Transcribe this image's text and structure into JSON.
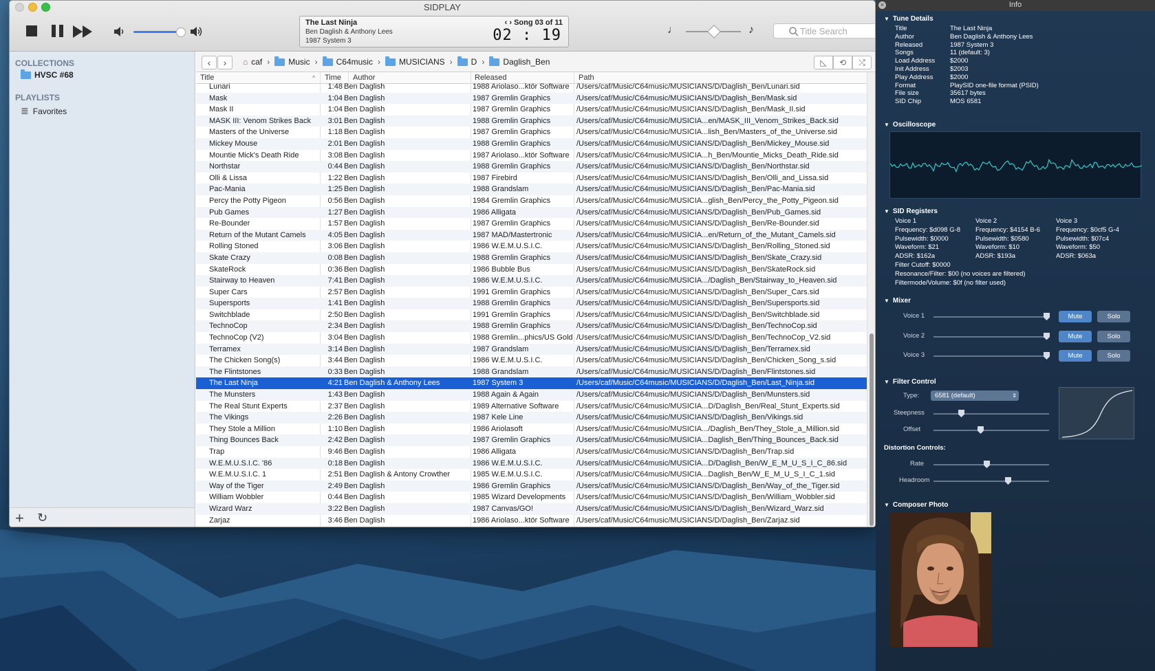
{
  "window": {
    "title": "SIDPLAY"
  },
  "now_playing": {
    "title": "The Last Ninja",
    "author": "Ben Daglish & Anthony Lees",
    "released": "1987 System 3",
    "song": "Song 03 of 11",
    "time": "02 : 19"
  },
  "search": {
    "placeholder": "Title Search"
  },
  "sidebar": {
    "collections_header": "COLLECTIONS",
    "collection": "HVSC #68",
    "playlists_header": "PLAYLISTS",
    "playlist": "Favorites"
  },
  "breadcrumb": [
    "caf",
    "Music",
    "C64music",
    "MUSICIANS",
    "D",
    "Daglish_Ben"
  ],
  "columns": {
    "title": "Title",
    "time": "Time",
    "author": "Author",
    "released": "Released",
    "path": "Path"
  },
  "rows": [
    [
      "Lunari",
      "1:48",
      "Ben Daglish",
      "1988 Ariolaso...ktör Software",
      "/Users/caf/Music/C64music/MUSICIANS/D/Daglish_Ben/Lunari.sid"
    ],
    [
      "Mask",
      "1:04",
      "Ben Daglish",
      "1987 Gremlin Graphics",
      "/Users/caf/Music/C64music/MUSICIANS/D/Daglish_Ben/Mask.sid"
    ],
    [
      "Mask II",
      "1:04",
      "Ben Daglish",
      "1987 Gremlin Graphics",
      "/Users/caf/Music/C64music/MUSICIANS/D/Daglish_Ben/Mask_II.sid"
    ],
    [
      "MASK III: Venom Strikes Back",
      "3:01",
      "Ben Daglish",
      "1988 Gremlin Graphics",
      "/Users/caf/Music/C64music/MUSICIA...en/MASK_III_Venom_Strikes_Back.sid"
    ],
    [
      "Masters of the Universe",
      "1:18",
      "Ben Daglish",
      "1987 Gremlin Graphics",
      "/Users/caf/Music/C64music/MUSICIA...lish_Ben/Masters_of_the_Universe.sid"
    ],
    [
      "Mickey Mouse",
      "2:01",
      "Ben Daglish",
      "1988 Gremlin Graphics",
      "/Users/caf/Music/C64music/MUSICIANS/D/Daglish_Ben/Mickey_Mouse.sid"
    ],
    [
      "Mountie Mick's Death Ride",
      "3:08",
      "Ben Daglish",
      "1987 Ariolaso...ktör Software",
      "/Users/caf/Music/C64music/MUSICIA...h_Ben/Mountie_Micks_Death_Ride.sid"
    ],
    [
      "Northstar",
      "0:44",
      "Ben Daglish",
      "1988 Gremlin Graphics",
      "/Users/caf/Music/C64music/MUSICIANS/D/Daglish_Ben/Northstar.sid"
    ],
    [
      "Olli & Lissa",
      "1:22",
      "Ben Daglish",
      "1987 Firebird",
      "/Users/caf/Music/C64music/MUSICIANS/D/Daglish_Ben/Olli_and_Lissa.sid"
    ],
    [
      "Pac-Mania",
      "1:25",
      "Ben Daglish",
      "1988 Grandslam",
      "/Users/caf/Music/C64music/MUSICIANS/D/Daglish_Ben/Pac-Mania.sid"
    ],
    [
      "Percy the Potty Pigeon",
      "0:56",
      "Ben Daglish",
      "1984 Gremlin Graphics",
      "/Users/caf/Music/C64music/MUSICIA...glish_Ben/Percy_the_Potty_Pigeon.sid"
    ],
    [
      "Pub Games",
      "1:27",
      "Ben Daglish",
      "1986 Alligata",
      "/Users/caf/Music/C64music/MUSICIANS/D/Daglish_Ben/Pub_Games.sid"
    ],
    [
      "Re-Bounder",
      "1:57",
      "Ben Daglish",
      "1987 Gremlin Graphics",
      "/Users/caf/Music/C64music/MUSICIANS/D/Daglish_Ben/Re-Bounder.sid"
    ],
    [
      "Return of the Mutant Camels",
      "4:05",
      "Ben Daglish",
      "1987 MAD/Mastertronic",
      "/Users/caf/Music/C64music/MUSICIA...en/Return_of_the_Mutant_Camels.sid"
    ],
    [
      "Rolling Stoned",
      "3:06",
      "Ben Daglish",
      "1986 W.E.M.U.S.I.C.",
      "/Users/caf/Music/C64music/MUSICIANS/D/Daglish_Ben/Rolling_Stoned.sid"
    ],
    [
      "Skate Crazy",
      "0:08",
      "Ben Daglish",
      "1988 Gremlin Graphics",
      "/Users/caf/Music/C64music/MUSICIANS/D/Daglish_Ben/Skate_Crazy.sid"
    ],
    [
      "SkateRock",
      "0:36",
      "Ben Daglish",
      "1986 Bubble Bus",
      "/Users/caf/Music/C64music/MUSICIANS/D/Daglish_Ben/SkateRock.sid"
    ],
    [
      "Stairway to Heaven",
      "7:41",
      "Ben Daglish",
      "1986 W.E.M.U.S.I.C.",
      "/Users/caf/Music/C64music/MUSICIA.../Daglish_Ben/Stairway_to_Heaven.sid"
    ],
    [
      "Super Cars",
      "2:57",
      "Ben Daglish",
      "1991 Gremlin Graphics",
      "/Users/caf/Music/C64music/MUSICIANS/D/Daglish_Ben/Super_Cars.sid"
    ],
    [
      "Supersports",
      "1:41",
      "Ben Daglish",
      "1988 Gremlin Graphics",
      "/Users/caf/Music/C64music/MUSICIANS/D/Daglish_Ben/Supersports.sid"
    ],
    [
      "Switchblade",
      "2:50",
      "Ben Daglish",
      "1991 Gremlin Graphics",
      "/Users/caf/Music/C64music/MUSICIANS/D/Daglish_Ben/Switchblade.sid"
    ],
    [
      "TechnoCop",
      "2:34",
      "Ben Daglish",
      "1988 Gremlin Graphics",
      "/Users/caf/Music/C64music/MUSICIANS/D/Daglish_Ben/TechnoCop.sid"
    ],
    [
      "TechnoCop (V2)",
      "3:04",
      "Ben Daglish",
      "1988 Gremlin...phics/US Gold",
      "/Users/caf/Music/C64music/MUSICIANS/D/Daglish_Ben/TechnoCop_V2.sid"
    ],
    [
      "Terramex",
      "3:14",
      "Ben Daglish",
      "1987 Grandslam",
      "/Users/caf/Music/C64music/MUSICIANS/D/Daglish_Ben/Terramex.sid"
    ],
    [
      "The Chicken Song(s)",
      "3:44",
      "Ben Daglish",
      "1986 W.E.M.U.S.I.C.",
      "/Users/caf/Music/C64music/MUSICIANS/D/Daglish_Ben/Chicken_Song_s.sid"
    ],
    [
      "The Flintstones",
      "0:33",
      "Ben Daglish",
      "1988 Grandslam",
      "/Users/caf/Music/C64music/MUSICIANS/D/Daglish_Ben/Flintstones.sid"
    ],
    [
      "The Last Ninja",
      "4:21",
      "Ben Daglish & Anthony Lees",
      "1987 System 3",
      "/Users/caf/Music/C64music/MUSICIANS/D/Daglish_Ben/Last_Ninja.sid"
    ],
    [
      "The Munsters",
      "1:43",
      "Ben Daglish",
      "1988 Again & Again",
      "/Users/caf/Music/C64music/MUSICIANS/D/Daglish_Ben/Munsters.sid"
    ],
    [
      "The Real Stunt Experts",
      "2:37",
      "Ben Daglish",
      "1989 Alternative Software",
      "/Users/caf/Music/C64music/MUSICIA...D/Daglish_Ben/Real_Stunt_Experts.sid"
    ],
    [
      "The Vikings",
      "2:26",
      "Ben Daglish",
      "1987 Kele Line",
      "/Users/caf/Music/C64music/MUSICIANS/D/Daglish_Ben/Vikings.sid"
    ],
    [
      "They Stole a Million",
      "1:10",
      "Ben Daglish",
      "1986 Ariolasoft",
      "/Users/caf/Music/C64music/MUSICIA.../Daglish_Ben/They_Stole_a_Million.sid"
    ],
    [
      "Thing Bounces Back",
      "2:42",
      "Ben Daglish",
      "1987 Gremlin Graphics",
      "/Users/caf/Music/C64music/MUSICIA...Daglish_Ben/Thing_Bounces_Back.sid"
    ],
    [
      "Trap",
      "9:46",
      "Ben Daglish",
      "1986 Alligata",
      "/Users/caf/Music/C64music/MUSICIANS/D/Daglish_Ben/Trap.sid"
    ],
    [
      "W.E.M.U.S.I.C. '86",
      "0:18",
      "Ben Daglish",
      "1986 W.E.M.U.S.I.C.",
      "/Users/caf/Music/C64music/MUSICIA...D/Daglish_Ben/W_E_M_U_S_I_C_86.sid"
    ],
    [
      "W.E.M.U.S.I.C. 1",
      "2:51",
      "Ben Daglish & Antony Crowther",
      "1985 W.E.M.U.S.I.C.",
      "/Users/caf/Music/C64music/MUSICIA...Daglish_Ben/W_E_M_U_S_I_C_1.sid"
    ],
    [
      "Way of the Tiger",
      "2:49",
      "Ben Daglish",
      "1986 Gremlin Graphics",
      "/Users/caf/Music/C64music/MUSICIANS/D/Daglish_Ben/Way_of_the_Tiger.sid"
    ],
    [
      "William Wobbler",
      "0:44",
      "Ben Daglish",
      "1985 Wizard Developments",
      "/Users/caf/Music/C64music/MUSICIANS/D/Daglish_Ben/William_Wobbler.sid"
    ],
    [
      "Wizard Warz",
      "3:22",
      "Ben Daglish",
      "1987 Canvas/GO!",
      "/Users/caf/Music/C64music/MUSICIANS/D/Daglish_Ben/Wizard_Warz.sid"
    ],
    [
      "Zarjaz",
      "3:46",
      "Ben Daglish",
      "1986 Ariolaso...ktör Software",
      "/Users/caf/Music/C64music/MUSICIANS/D/Daglish_Ben/Zarjaz.sid"
    ]
  ],
  "selected_row": 26,
  "info": {
    "title": "Info",
    "tune_header": "Tune Details",
    "tune": [
      [
        "Title",
        "The Last Ninja"
      ],
      [
        "Author",
        "Ben Daglish & Anthony Lees"
      ],
      [
        "Released",
        "1987 System 3"
      ],
      [
        "Songs",
        "11 (default: 3)"
      ],
      [
        "Load Address",
        "$2000"
      ],
      [
        "Init Address",
        "$2003"
      ],
      [
        "Play Address",
        "$2000"
      ],
      [
        "Format",
        "PlaySID one-file format (PSID)"
      ],
      [
        "File size",
        "35617 bytes"
      ],
      [
        "SID Chip",
        "MOS 6581"
      ]
    ],
    "osc_header": "Oscilloscope",
    "regs_header": "SID Registers",
    "voices": [
      [
        "Voice 1",
        "Frequency: $d098  G-8",
        "Pulsewidth: $0000",
        "Waveform: $21",
        "ADSR: $162a"
      ],
      [
        "Voice 2",
        "Frequency: $4154  B-6",
        "Pulsewidth: $0580",
        "Waveform: $10",
        "ADSR: $193a"
      ],
      [
        "Voice 3",
        "Frequency: $0cf5   G-4",
        "Pulsewidth: $07c4",
        "Waveform: $50",
        "ADSR: $063a"
      ]
    ],
    "filter_lines": [
      "Filter Cutoff: $0000",
      "Resonance/Filter: $00 (no voices are filtered)",
      "Filtermode/Volume: $0f (no filter used)"
    ],
    "mixer_header": "Mixer",
    "mixer": [
      "Voice 1",
      "Voice 2",
      "Voice 3"
    ],
    "mute": "Mute",
    "solo": "Solo",
    "filter_header": "Filter Control",
    "type_label": "Type:",
    "type_value": "6581 (default)",
    "steepness": "Steepness",
    "offset": "Offset",
    "distortion_header": "Distortion Controls:",
    "rate": "Rate",
    "headroom": "Headroom",
    "photo_header": "Composer Photo"
  }
}
